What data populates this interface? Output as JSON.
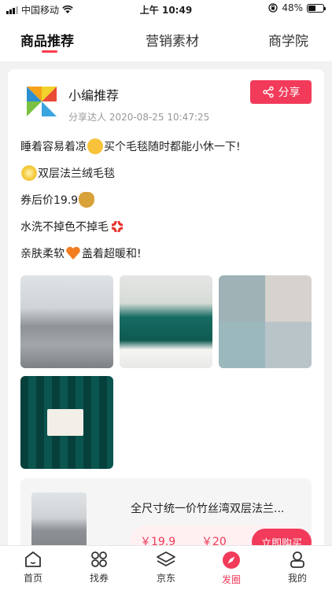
{
  "status_bar": {
    "carrier": "中国移动",
    "time": "上午 10:49",
    "battery": "48%",
    "battery_level": 0.48
  },
  "tabs": [
    {
      "label": "商品推荐",
      "active": true
    },
    {
      "label": "营销素材",
      "active": false
    },
    {
      "label": "商学院",
      "active": false
    }
  ],
  "post": {
    "author": "小编推荐",
    "meta": "分享达人 2020-08-25 10:47:25",
    "share_label": "分享",
    "lines": [
      {
        "before": "睡着容易着凉",
        "emoji": "sleepy-face-emoji",
        "after": "买个毛毯随时都能小休一下!"
      },
      {
        "before": "",
        "emoji": "sparkle-emoji",
        "after": "双层法兰绒毛毯"
      },
      {
        "before": "券后价19.9",
        "emoji": "money-bag-emoji",
        "after": ""
      },
      {
        "before": "水洗不掉色不掉毛",
        "emoji": "anger-symbol-emoji",
        "after": ""
      },
      {
        "before": "亲肤柔软",
        "emoji": "orange-heart-emoji",
        "after": "盖着超暖和!"
      }
    ]
  },
  "product": {
    "title": "全尺寸统一价竹丝湾双层法兰...",
    "price": "￥19.9",
    "original_price": "￥20",
    "buy_label": "立即购买"
  },
  "bottom_nav": [
    {
      "label": "首页",
      "icon": "home-icon",
      "active": false
    },
    {
      "label": "找券",
      "icon": "coupon-grid-icon",
      "active": false
    },
    {
      "label": "京东",
      "icon": "layers-icon",
      "active": false
    },
    {
      "label": "发圈",
      "icon": "compass-icon",
      "active": true
    },
    {
      "label": "我的",
      "icon": "profile-icon",
      "active": false
    }
  ],
  "colors": {
    "accent": "#f23a5a",
    "background": "#f2f2f2"
  }
}
